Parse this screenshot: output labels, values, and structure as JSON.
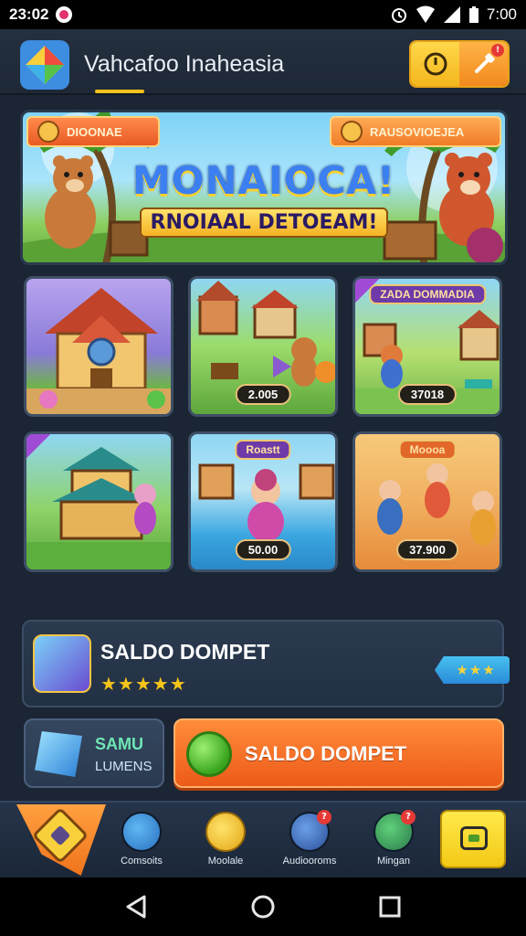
{
  "status_bar": {
    "time_left": "23:02",
    "time_right": "7:00"
  },
  "header": {
    "title": "Vahcafoo Inaheasia"
  },
  "banner": {
    "badge_left": "DIOONAE",
    "badge_right": "RAUSOVIOEJEA",
    "title": "MONAIOCA!",
    "subtitle": "RNOIAAL DETOEAM!"
  },
  "games": [
    {
      "tag": "",
      "title": ""
    },
    {
      "tag": "2.005",
      "title": ""
    },
    {
      "tag": "37018",
      "title": "ZADA DOMMADIA"
    },
    {
      "tag": "",
      "title": ""
    },
    {
      "tag": "50.00",
      "title": "Roastt"
    },
    {
      "tag": "37.900",
      "title": "Moooa"
    }
  ],
  "balance": {
    "label": "SALDO DOMPET",
    "stars": "★★★★★",
    "rating": "★★★"
  },
  "actions": {
    "docs_line1": "SAMU",
    "docs_line2": "LUMENS",
    "saldo_label": "SALDO DOMPET"
  },
  "bottom_nav": {
    "items": [
      {
        "label": "Comsoits",
        "badge": ""
      },
      {
        "label": "Moolale",
        "badge": ""
      },
      {
        "label": "Audiooroms",
        "badge": "?"
      },
      {
        "label": "Mingan",
        "badge": "?"
      }
    ]
  },
  "colors": {
    "background": "#1b2533",
    "accent_orange": "#ed5a19",
    "accent_yellow": "#f3c915"
  }
}
